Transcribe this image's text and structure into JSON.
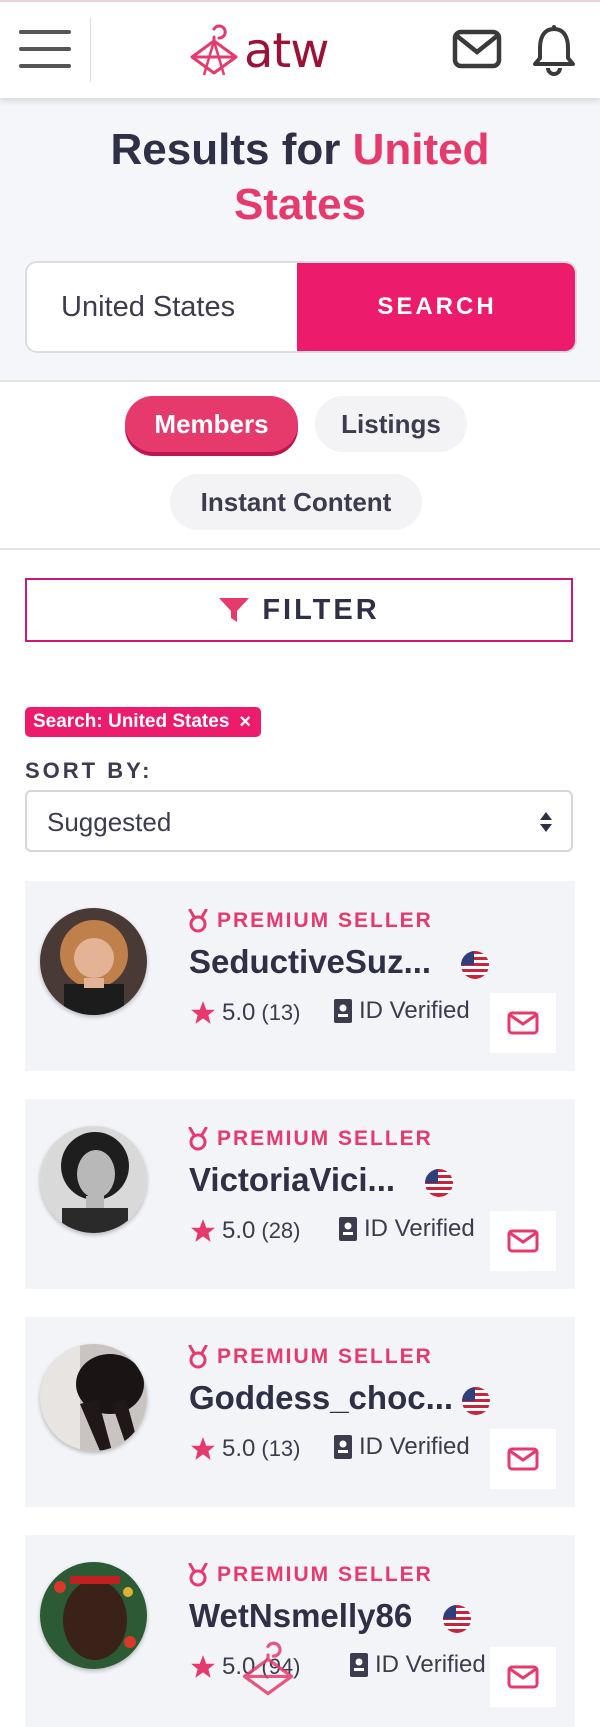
{
  "header": {
    "logo_text": "atw",
    "brand_color": "#9b1236",
    "icons": [
      "menu-icon",
      "mail-icon",
      "bell-icon"
    ]
  },
  "results": {
    "title_prefix": "Results for ",
    "title_highlight": "United States"
  },
  "search": {
    "value": "United States",
    "button_label": "SEARCH"
  },
  "tabs": [
    {
      "label": "Members",
      "active": true
    },
    {
      "label": "Listings",
      "active": false
    },
    {
      "label": "Instant Content",
      "active": false
    }
  ],
  "filter": {
    "label": "FILTER",
    "icon": "funnel-icon"
  },
  "search_tag": {
    "label": "Search: United States",
    "close": "×"
  },
  "sort": {
    "label": "SORT BY:",
    "value": "Suggested"
  },
  "sellers": [
    {
      "badge": "PREMIUM SELLER",
      "name": "SeductiveSuz...",
      "rating": "5.0",
      "count": "(13)",
      "verified": "ID Verified"
    },
    {
      "badge": "PREMIUM SELLER",
      "name": "VictoriaVici...",
      "rating": "5.0",
      "count": "(28)",
      "verified": "ID Verified"
    },
    {
      "badge": "PREMIUM SELLER",
      "name": "Goddess_choc...",
      "rating": "5.0",
      "count": "(13)",
      "verified": "ID Verified"
    },
    {
      "badge": "PREMIUM SELLER",
      "name": "WetNsmelly86",
      "rating": "5.0",
      "count": "(94)",
      "verified": "ID Verified"
    }
  ],
  "colors": {
    "accent": "#ec1b6b",
    "accent_soft": "#e63a6d",
    "text": "#2f2f45",
    "card_bg": "#f3f4f8"
  }
}
